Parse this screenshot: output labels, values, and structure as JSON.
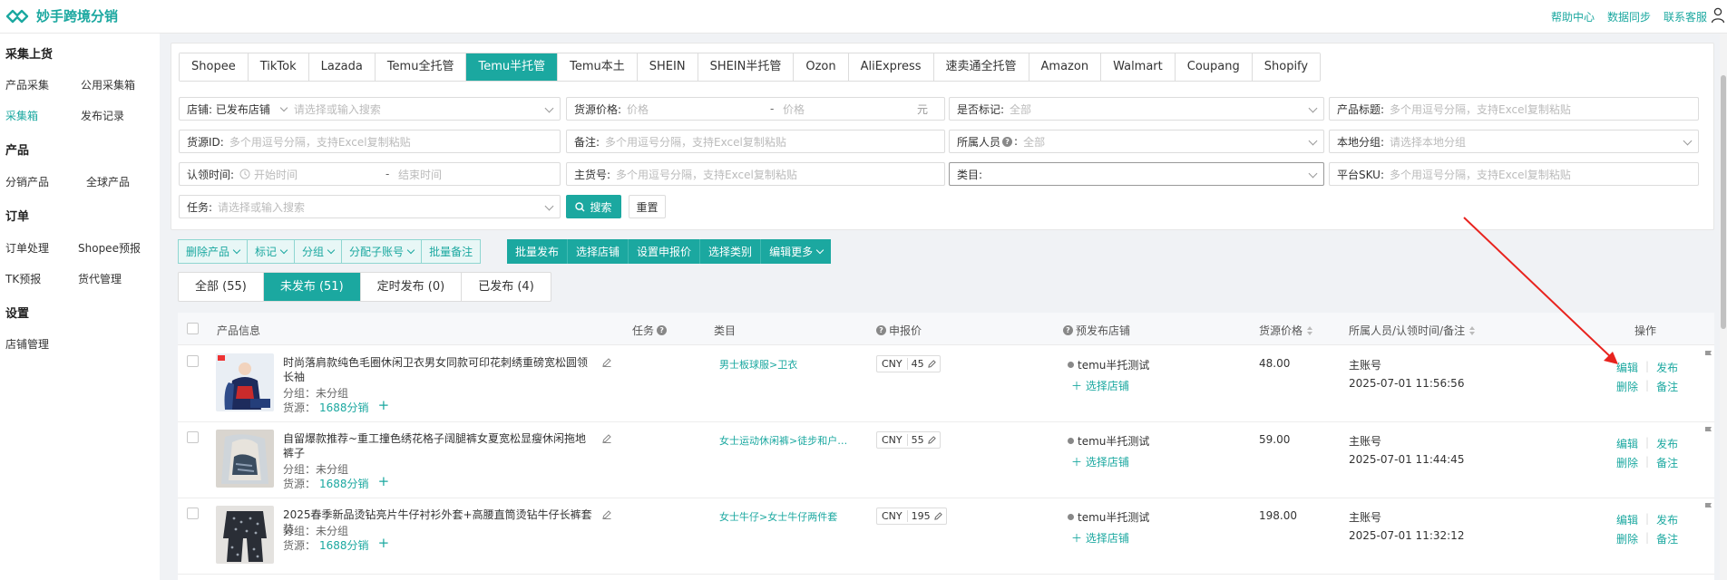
{
  "app": {
    "name": "妙手跨境分销",
    "top_links": [
      "帮助中心",
      "数据同步",
      "联系客服"
    ],
    "colors": {
      "accent": "#1ba8a0",
      "annotation": "#e8231e"
    }
  },
  "sidebar": {
    "groups": [
      {
        "title": "采集上货",
        "items": [
          "产品采集",
          "公用采集箱",
          "采集箱",
          "发布记录"
        ]
      },
      {
        "title": "产品",
        "items": [
          "分销产品",
          "全球产品"
        ]
      },
      {
        "title": "订单",
        "items": [
          "订单处理",
          "Shopee预报",
          "TK预报",
          "货代管理"
        ]
      },
      {
        "title": "设置",
        "items": [
          "店铺管理"
        ]
      }
    ],
    "active": "采集箱"
  },
  "platform_tabs": [
    "Shopee",
    "TikTok",
    "Lazada",
    "Temu全托管",
    "Temu半托管",
    "Temu本土",
    "SHEIN",
    "SHEIN半托管",
    "Ozon",
    "AliExpress",
    "速卖通全托管",
    "Amazon",
    "Walmart",
    "Coupang",
    "Shopify"
  ],
  "platform_active": "Temu半托管",
  "filters": {
    "shop_label": "店铺: 已发布店铺",
    "shop_placeholder": "请选择或输入搜索",
    "price_label": "货源价格:",
    "price_min": "价格",
    "price_dash": "-",
    "price_max": "价格",
    "price_unit": "元",
    "marked_label": "是否标记:",
    "marked_value": "全部",
    "title_label": "产品标题:",
    "title_placeholder": "多个用逗号分隔，支持Excel复制粘贴",
    "source_id_label": "货源ID:",
    "source_id_placeholder": "多个用逗号分隔，支持Excel复制粘贴",
    "remark_label": "备注:",
    "remark_placeholder": "多个用逗号分隔，支持Excel复制粘贴",
    "owner_label": "所属人员",
    "owner_value": "全部",
    "local_group_label": "本地分组:",
    "local_group_placeholder": "请选择本地分组",
    "claim_time_label": "认领时间:",
    "claim_start": "开始时间",
    "claim_dash": "-",
    "claim_end": "结束时间",
    "main_no_label": "主货号:",
    "main_no_placeholder": "多个用逗号分隔，支持Excel复制粘贴",
    "category_label": "类目:",
    "sku_label": "平台SKU:",
    "sku_placeholder": "多个用逗号分隔，支持Excel复制粘贴",
    "task_label": "任务:",
    "task_placeholder": "请选择或输入搜索",
    "search_btn": "搜索",
    "reset_btn": "重置"
  },
  "actions": {
    "light": [
      {
        "label": "删除产品",
        "dropdown": true
      },
      {
        "label": "标记",
        "dropdown": true
      },
      {
        "label": "分组",
        "dropdown": true
      },
      {
        "label": "分配子账号",
        "dropdown": true
      },
      {
        "label": "批量备注",
        "dropdown": false
      }
    ],
    "dark": [
      {
        "label": "批量发布",
        "dropdown": false
      },
      {
        "label": "选择店铺",
        "dropdown": false
      },
      {
        "label": "设置申报价",
        "dropdown": false
      },
      {
        "label": "选择类别",
        "dropdown": false
      },
      {
        "label": "编辑更多",
        "dropdown": true
      }
    ]
  },
  "status_tabs": [
    "全部 (55)",
    "未发布 (51)",
    "定时发布 (0)",
    "已发布 (4)"
  ],
  "status_active": "未发布 (51)",
  "table": {
    "headers": {
      "product": "产品信息",
      "task": "任务",
      "category": "类目",
      "declared": "申报价",
      "shop": "预发布店铺",
      "price": "货源价格",
      "owner": "所属人员/认领时间/备注",
      "ops": "操作"
    },
    "rows": [
      {
        "title": "时尚落肩款纯色毛圈休闲卫衣男女同款可印花刺绣重磅宽松圆领长袖",
        "group": "分组：未分组",
        "source_label": "货源：",
        "source_link": "1688分销",
        "category": "男士板球服>卫衣",
        "currency": "CNY",
        "declared": "45",
        "shop": "temu半托测试",
        "choose_shop": "选择店铺",
        "price": "48.00",
        "owner": "主账号",
        "time": "2025-07-01 11:56:56",
        "ops": [
          "编辑",
          "发布",
          "删除",
          "备注"
        ]
      },
      {
        "title": "自留爆款推荐~重工撞色绣花格子阔腿裤女夏宽松显瘦休闲拖地裤子",
        "group": "分组：未分组",
        "source_label": "货源：",
        "source_link": "1688分销",
        "category": "女士运动休闲裤>徒步和户…",
        "currency": "CNY",
        "declared": "55",
        "shop": "temu半托测试",
        "choose_shop": "选择店铺",
        "price": "59.00",
        "owner": "主账号",
        "time": "2025-07-01 11:44:45",
        "ops": [
          "编辑",
          "发布",
          "删除",
          "备注"
        ]
      },
      {
        "title": "2025春季新品烫钻亮片牛仔衬衫外套+高腰直筒烫钻牛仔长裤套装",
        "group": "分组：未分组",
        "source_label": "货源：",
        "source_link": "1688分销",
        "category": "女士牛仔>女士牛仔两件套",
        "currency": "CNY",
        "declared": "195",
        "shop": "temu半托测试",
        "choose_shop": "选择店铺",
        "price": "198.00",
        "owner": "主账号",
        "time": "2025-07-01 11:32:12",
        "ops": [
          "编辑",
          "发布",
          "删除",
          "备注"
        ]
      }
    ]
  }
}
